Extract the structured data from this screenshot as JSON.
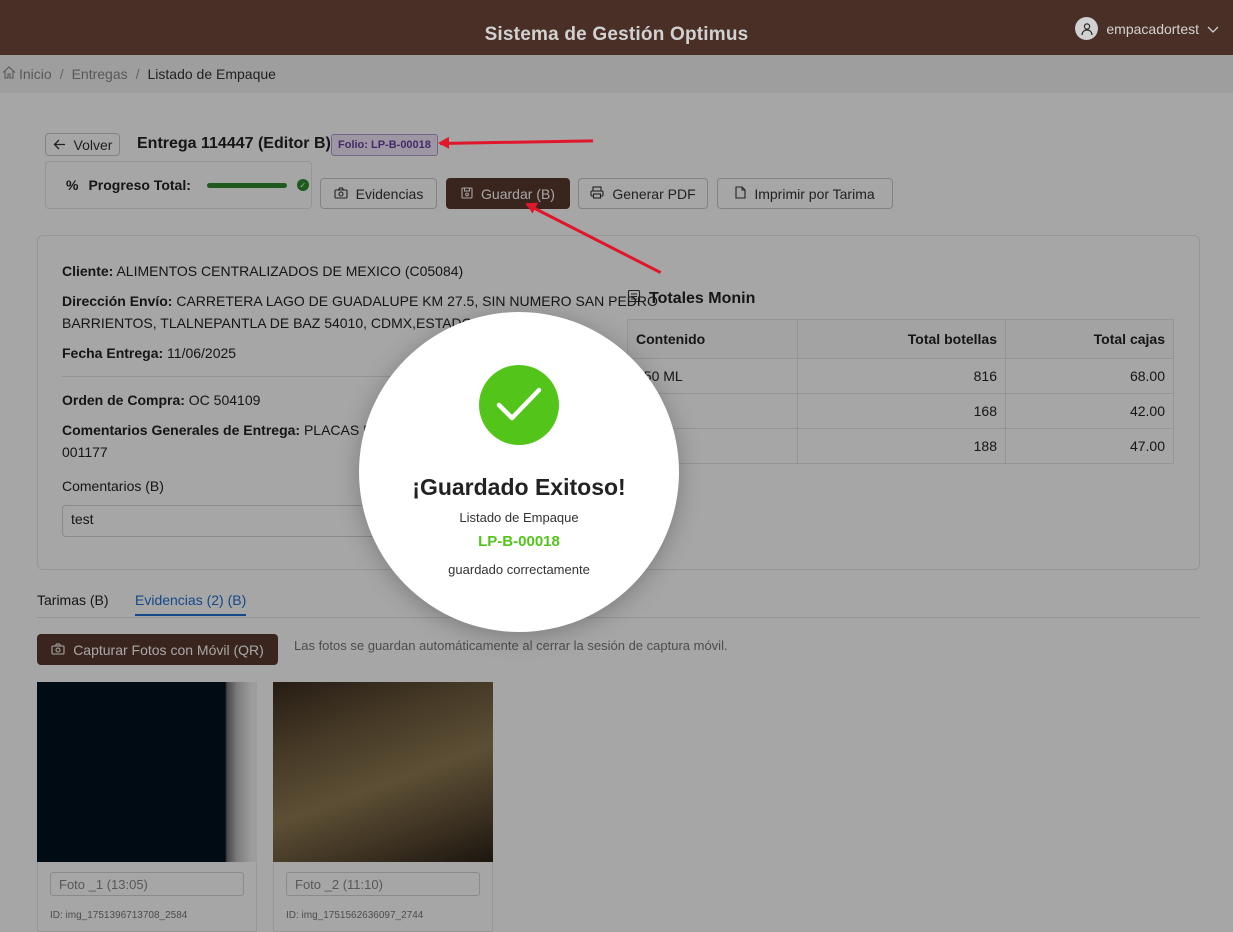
{
  "header": {
    "title": "Sistema de Gestión Optimus",
    "username": "empacadortest"
  },
  "breadcrumb": {
    "home": "Inicio",
    "deliveries": "Entregas",
    "current": "Listado de Empaque"
  },
  "toolbar": {
    "back_label": "Volver",
    "heading": "Entrega 114447 (Editor B)",
    "folio_badge": "Folio: LP-B-00018",
    "progress_label": "Progreso Total:",
    "progress_value": 1.0,
    "evidencias_label": "Evidencias",
    "guardar_label": "Guardar (B)",
    "pdf_label": "Generar PDF",
    "imprimir_label": "Imprimir por Tarima"
  },
  "details": {
    "cliente_label": "Cliente:",
    "cliente_value": "ALIMENTOS CENTRALIZADOS DE MEXICO (C05084)",
    "direccion_label": "Dirección Envío:",
    "direccion_value": "CARRETERA LAGO DE GUADALUPE KM 27.5, SIN NUMERO SAN PEDRO",
    "direccion_value2": "BARRIENTOS, TLALNEPANTLA DE BAZ 54010, CDMX,ESTADO DE M",
    "fecha_label": "Fecha Entrega:",
    "fecha_value": "11/06/2025",
    "orden_label": "Orden de Compra:",
    "orden_value": "OC 504109",
    "comentarios_gen_label": "Comentarios Generales de Entrega:",
    "comentarios_gen_value": "PLACAS DE",
    "comentarios_gen_value2": "001177",
    "comentarios_b_label": "Comentarios (B)",
    "comentarios_b_value": "test"
  },
  "totales": {
    "title": "Totales Monin",
    "columns": [
      "Contenido",
      "Total botellas",
      "Total cajas"
    ],
    "rows": [
      [
        "750 ML",
        "816",
        "68.00"
      ],
      [
        "",
        "168",
        "42.00"
      ],
      [
        "",
        "188",
        "47.00"
      ]
    ]
  },
  "tabs": [
    {
      "label": "Tarimas (B)",
      "active": false
    },
    {
      "label": "Evidencias (2) (B)",
      "active": true
    }
  ],
  "evidencias": {
    "capture_label": "Capturar Fotos con Móvil (QR)",
    "note": "Las fotos se guardan automáticamente al cerrar la sesión de captura móvil.",
    "photos": [
      {
        "name": "Foto _1 (13:05)",
        "id": "ID: img_1751396713708_2584"
      },
      {
        "name": "Foto _2 (11:10)",
        "id": "ID: img_1751562636097_2744"
      }
    ]
  },
  "modal": {
    "title": "¡Guardado Exitoso!",
    "subtitle": "Listado de Empaque",
    "folio": "LP-B-00018",
    "message": "guardado correctamente"
  },
  "colors": {
    "brand": "#5a3a2e",
    "success": "#52c41a",
    "progress": "#2e8b2e",
    "link": "#1f6fd1",
    "annotation_arrow": "#e0162b",
    "folio_badge": "#6b3fa0"
  },
  "icons": [
    "user-icon",
    "chevron-down-icon",
    "home-icon",
    "arrow-left-icon",
    "percent-icon",
    "check-icon",
    "camera-icon",
    "save-icon",
    "printer-icon",
    "file-icon",
    "table-icon"
  ]
}
